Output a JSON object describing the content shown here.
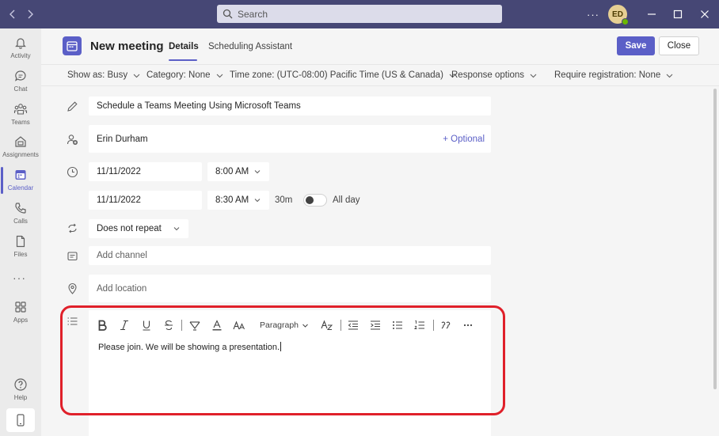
{
  "titlebar": {
    "search_placeholder": "Search",
    "more_label": "···",
    "avatar_initials": "ED"
  },
  "rail": {
    "items": [
      {
        "label": "Activity",
        "icon": "bell-icon"
      },
      {
        "label": "Chat",
        "icon": "chat-icon"
      },
      {
        "label": "Teams",
        "icon": "teams-icon"
      },
      {
        "label": "Assignments",
        "icon": "assignments-icon"
      },
      {
        "label": "Calendar",
        "icon": "calendar-icon"
      },
      {
        "label": "Calls",
        "icon": "phone-icon"
      },
      {
        "label": "Files",
        "icon": "file-icon"
      },
      {
        "label": "Apps",
        "icon": "apps-icon"
      },
      {
        "label": "Help",
        "icon": "help-icon"
      }
    ],
    "more": "···"
  },
  "header": {
    "title": "New meeting",
    "tabs": [
      "Details",
      "Scheduling Assistant"
    ],
    "save_label": "Save",
    "close_label": "Close"
  },
  "options": {
    "show_as": "Show as: Busy",
    "category": "Category: None",
    "time_zone": "Time zone: (UTC-08:00) Pacific Time (US & Canada)",
    "response": "Response options",
    "registration": "Require registration: None"
  },
  "form": {
    "title_value": "Schedule a Teams Meeting Using Microsoft Teams",
    "attendee_value": "Erin Durham",
    "optional_label": "+ Optional",
    "start_date": "11/11/2022",
    "start_time": "8:00 AM",
    "end_date": "11/11/2022",
    "end_time": "8:30 AM",
    "duration": "30m",
    "all_day_label": "All day",
    "all_day_on": false,
    "repeat": "Does not repeat",
    "channel_placeholder": "Add channel",
    "location_placeholder": "Add location"
  },
  "editor": {
    "paragraph_label": "Paragraph",
    "body": "Please join. We will be showing a presentation."
  },
  "colors": {
    "titlebar": "#464775",
    "accent": "#5b5fc7",
    "highlight": "#e0202a"
  }
}
